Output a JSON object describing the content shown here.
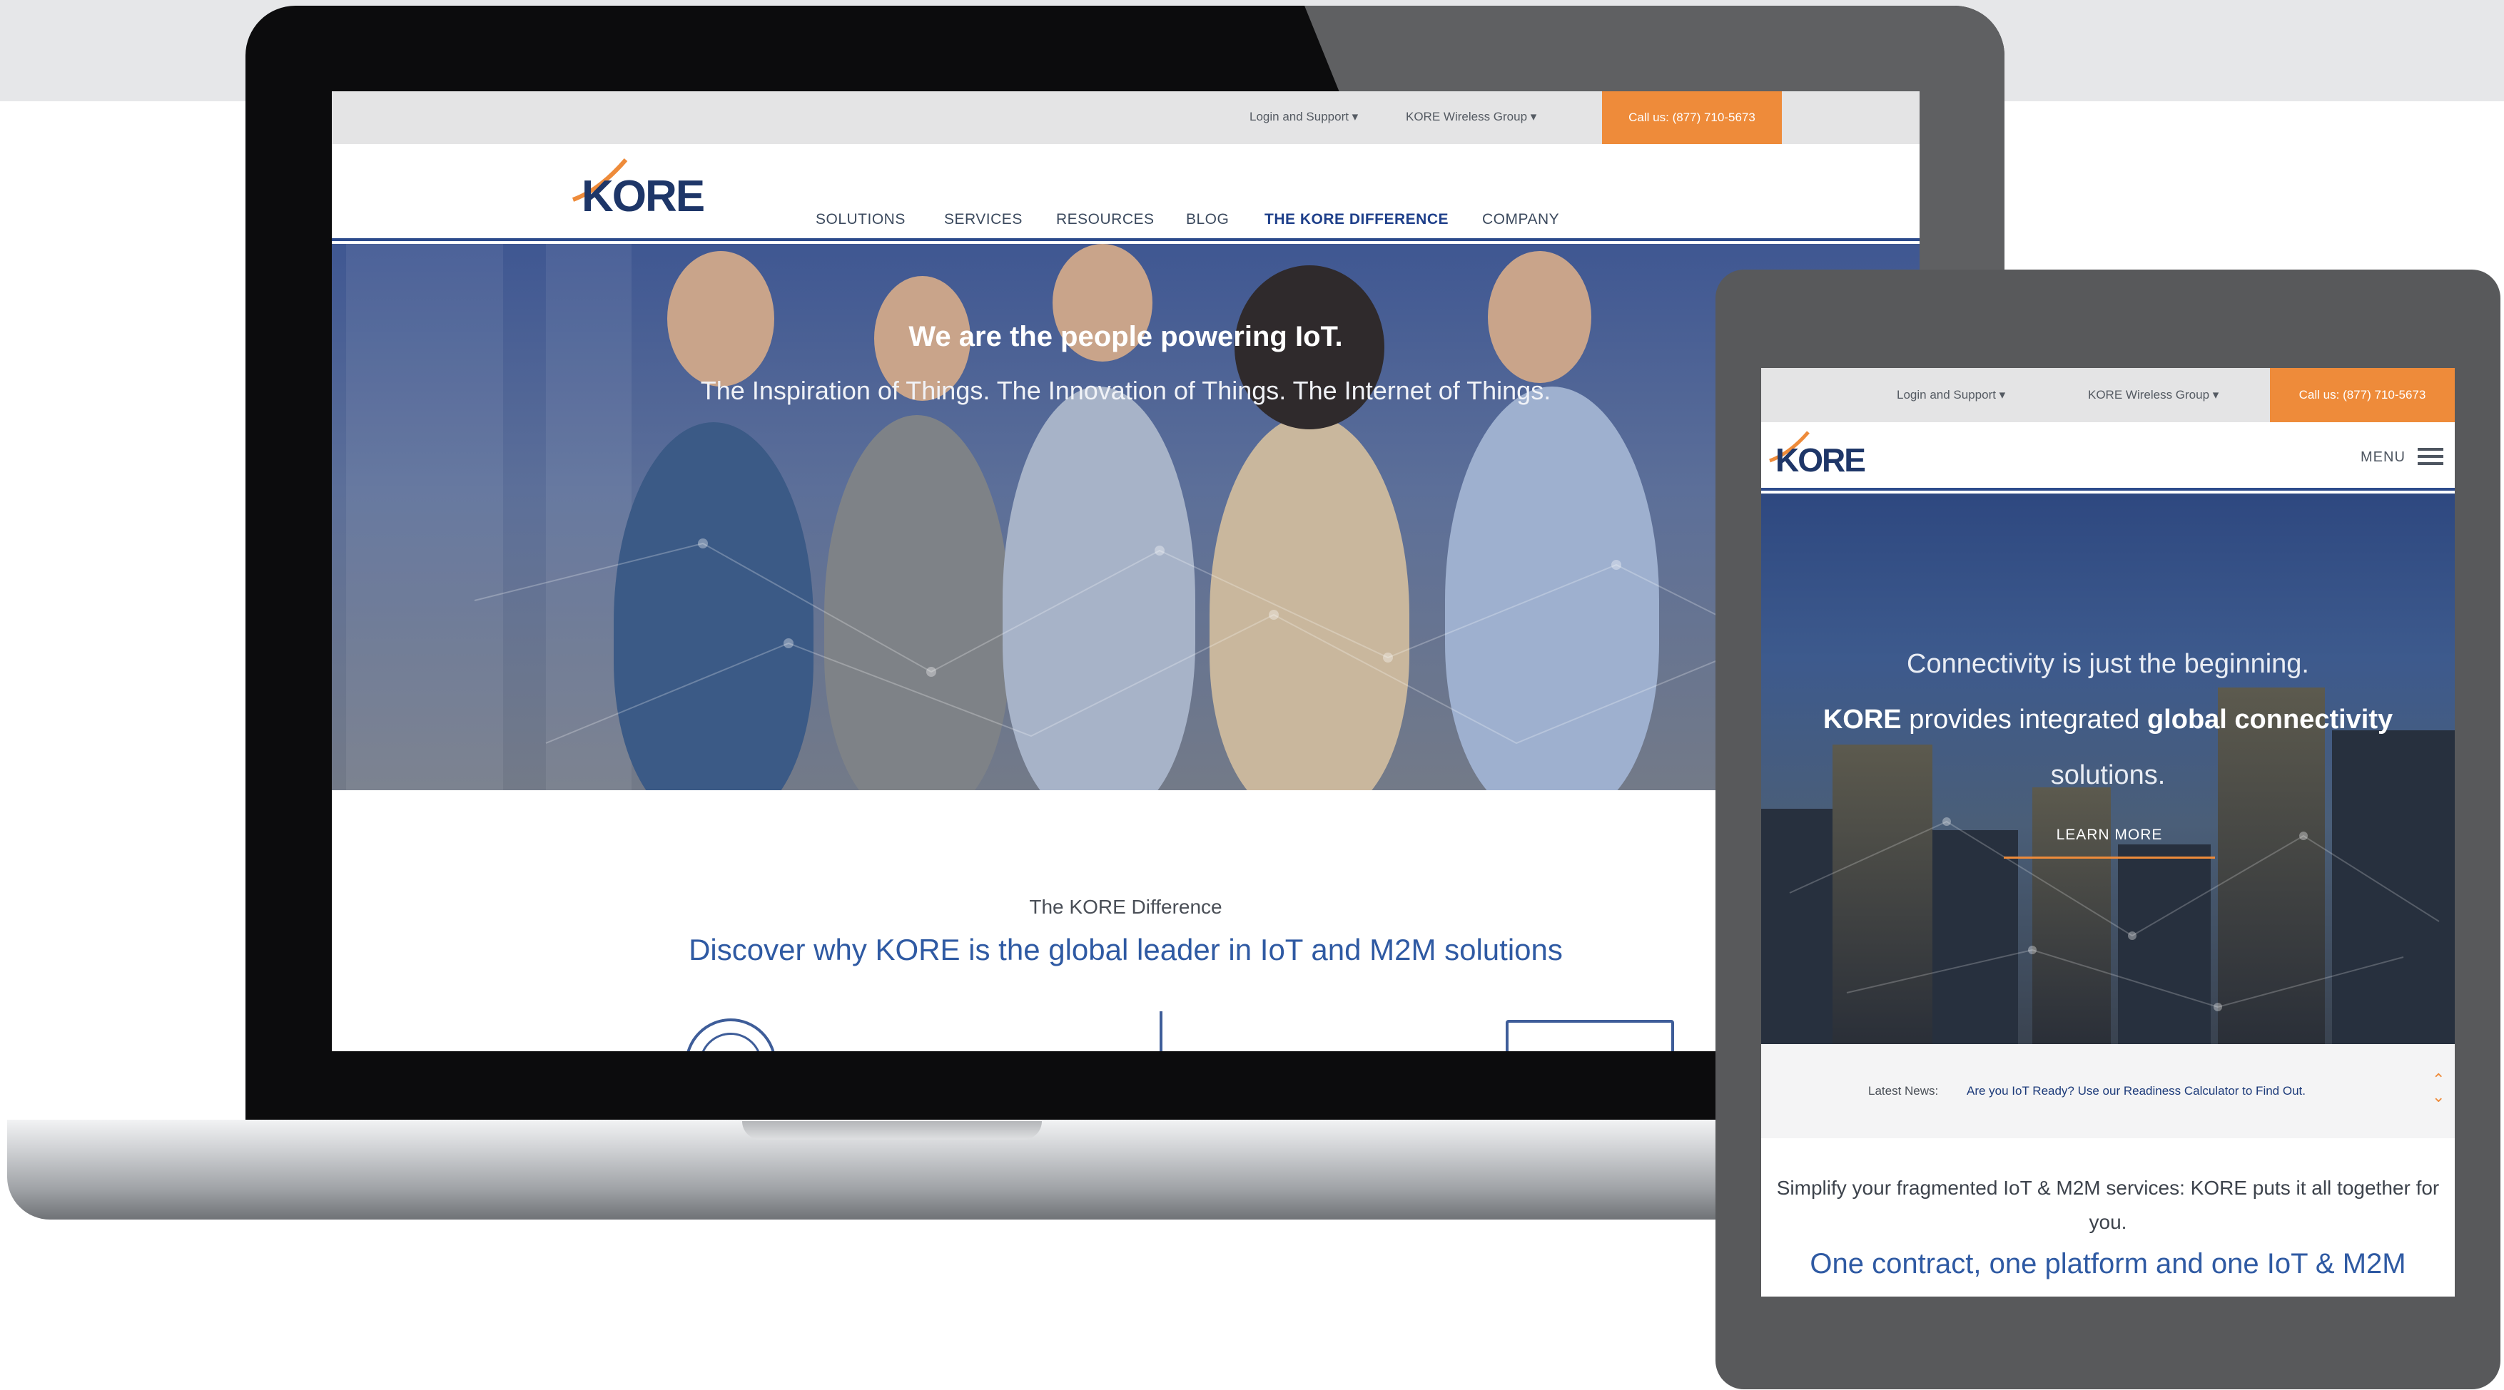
{
  "laptop": {
    "top_links": [
      "Login and Support",
      "KORE Wireless Group"
    ],
    "call": "Call us: (877) 710-5673",
    "logo": "KORE",
    "nav": [
      "SOLUTIONS",
      "SERVICES",
      "RESOURCES",
      "BLOG",
      "THE KORE DIFFERENCE",
      "COMPANY"
    ],
    "hero_title": "We are the people powering IoT.",
    "hero_subtitle": "The Inspiration of Things. The Innovation of Things. The Internet of Things.",
    "section_label": "The KORE Difference",
    "section_heading": "Discover why KORE is the global leader in IoT and M2M solutions"
  },
  "tablet": {
    "top_links": [
      "Login and Support",
      "KORE Wireless Group"
    ],
    "call": "Call us: (877) 710-5673",
    "logo": "KORE",
    "menu": "MENU",
    "hero_line1": "Connectivity is just the beginning.",
    "hero_line2_a": "KORE",
    "hero_line2_b": " provides integrated ",
    "hero_line2_c": "global connectivity",
    "hero_line3": "solutions.",
    "learn_more": "LEARN MORE",
    "news_label": "Latest News:",
    "news_text": "Are you IoT Ready? Use our Readiness Calculator to Find Out.",
    "body1": "Simplify your fragmented IoT & M2M services: KORE puts it all together for you.",
    "body2": "One contract, one platform and one IoT & M2M"
  },
  "colors": {
    "brand_blue": "#1e3668",
    "accent_orange": "#ee8b3a",
    "link_blue": "#2f5aa3"
  }
}
